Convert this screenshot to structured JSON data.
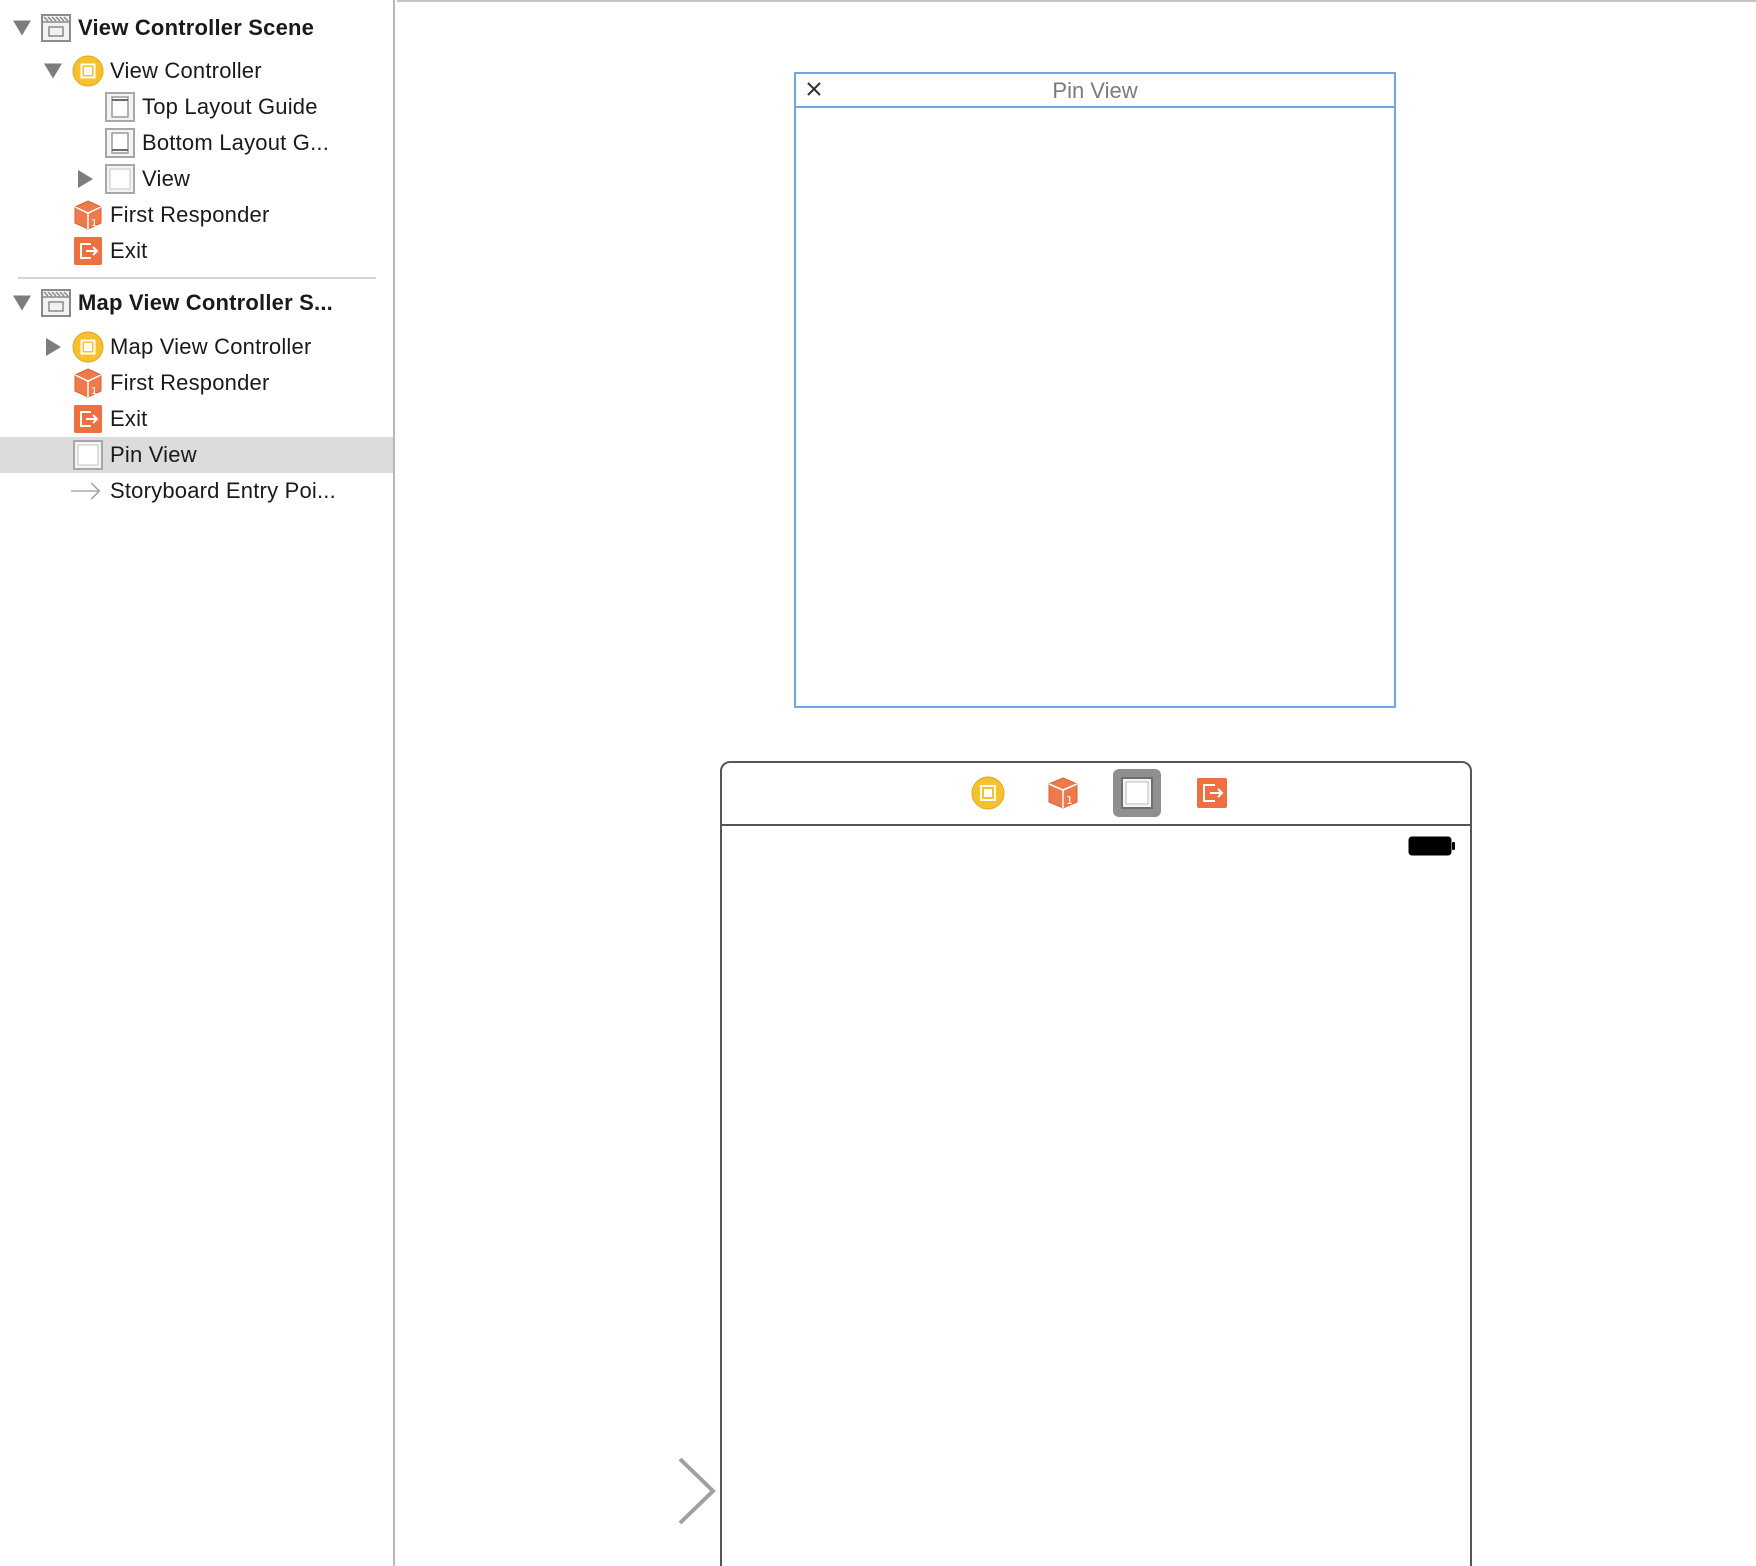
{
  "outline": {
    "scene1": {
      "title": "View Controller Scene",
      "view_controller": "View Controller",
      "top_layout_guide": "Top Layout Guide",
      "bottom_layout_guide": "Bottom Layout G...",
      "view": "View",
      "first_responder": "First Responder",
      "exit": "Exit"
    },
    "scene2": {
      "title": "Map View Controller S...",
      "map_view_controller": "Map View Controller",
      "first_responder": "First Responder",
      "exit": "Exit",
      "pin_view": "Pin View",
      "storyboard_entry": "Storyboard Entry Poi..."
    },
    "selected_item": "Pin View"
  },
  "canvas": {
    "pin_window_title": "Pin View"
  },
  "colors": {
    "selection_blue": "#6ea6de",
    "controller_yellow": "#f5c12e",
    "responder_orange": "#ee7a4b",
    "exit_orange": "#ee6f3f",
    "row_selected": "#dcdcdc"
  }
}
